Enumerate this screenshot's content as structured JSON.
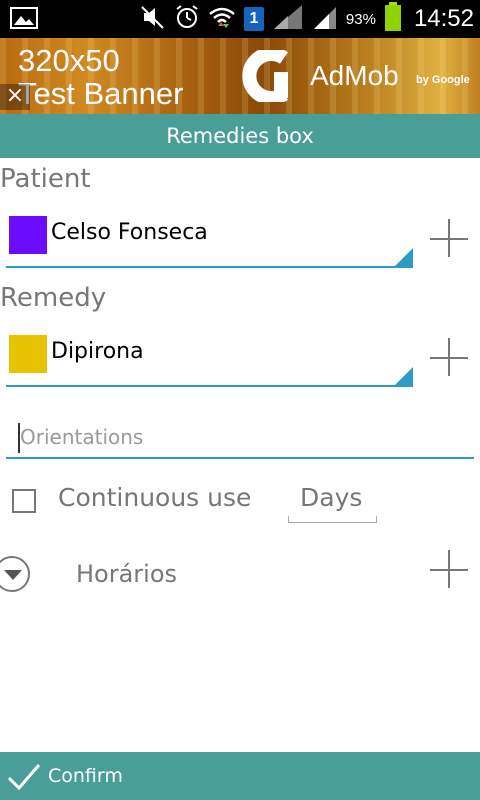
{
  "status_bar": {
    "battery_percent": "93%",
    "time": "14:52",
    "notification_badge": "1",
    "icons": [
      "image-icon",
      "mute-icon",
      "alarm-icon",
      "wifi-icon",
      "signal-icon",
      "battery-icon"
    ]
  },
  "ad_banner": {
    "title_line1": "320x50",
    "title_line2": "Test Banner",
    "close_label": "×",
    "brand": "AdMob",
    "brand_sub": "by Google"
  },
  "toolbar": {
    "title": "Remedies box"
  },
  "form": {
    "patient_label": "Patient",
    "patient_value": "Celso Fonseca",
    "patient_color": "#6a0cff",
    "remedy_label": "Remedy",
    "remedy_value": "Dipirona",
    "remedy_color": "#e6c200",
    "orientations_placeholder": "Orientations",
    "continuous_use_label": "Continuous use",
    "continuous_use_checked": false,
    "days_placeholder": "Days",
    "schedules_label": "Horários"
  },
  "bottom_bar": {
    "confirm_label": "Confirm"
  },
  "colors": {
    "accent": "#4a9e98",
    "underline": "#2e9bc4"
  }
}
